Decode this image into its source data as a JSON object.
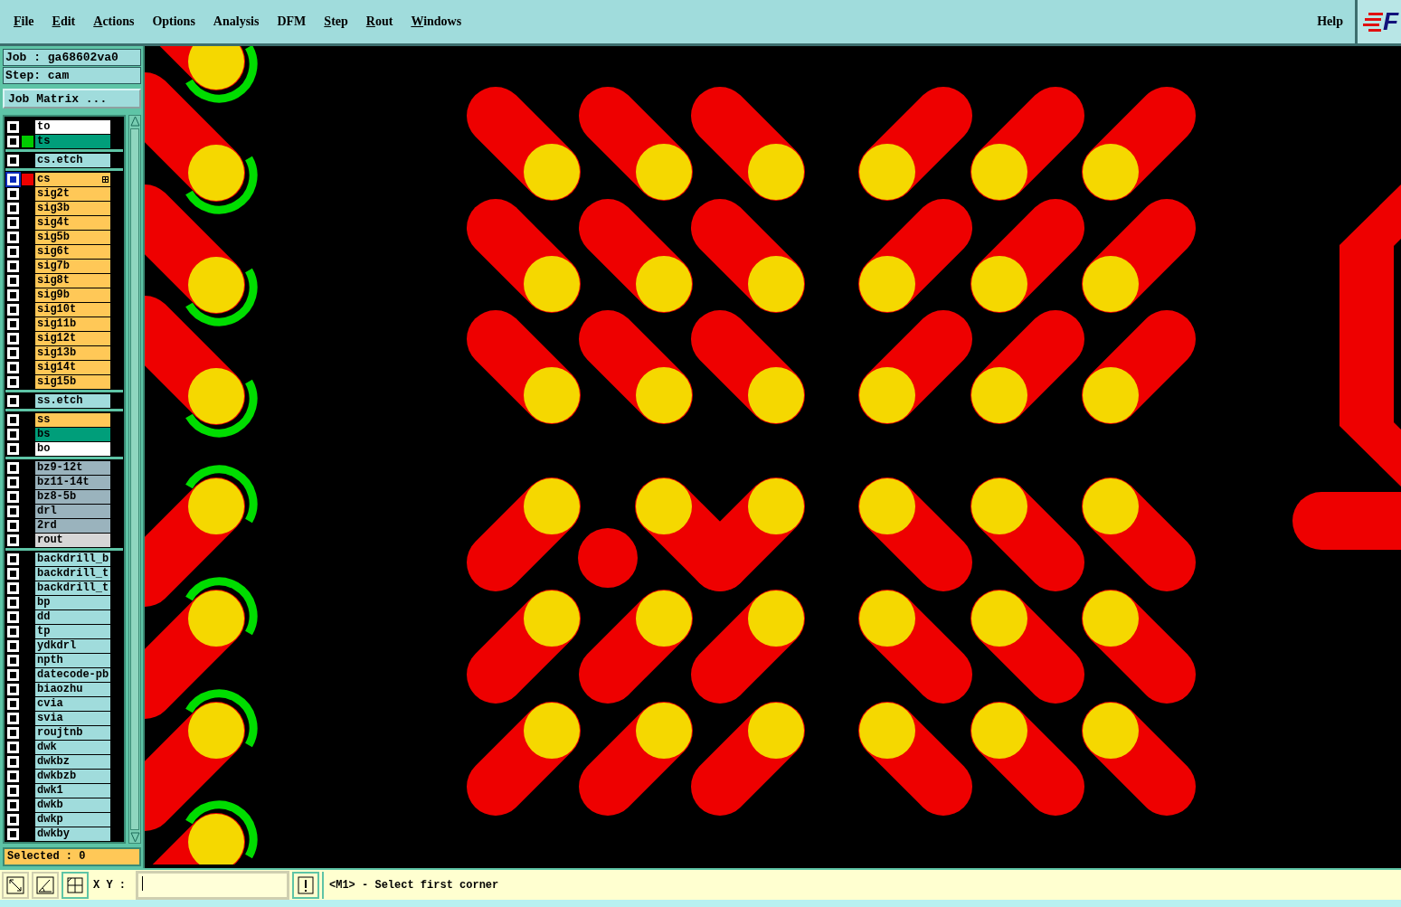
{
  "menu_bar": {
    "items": [
      {
        "label": "File",
        "mnemonic": true
      },
      {
        "label": "Edit",
        "mnemonic": true
      },
      {
        "label": "Actions",
        "mnemonic": true
      },
      {
        "label": "Options",
        "mnemonic": false
      },
      {
        "label": "Analysis",
        "mnemonic": false
      },
      {
        "label": "DFM",
        "mnemonic": false
      },
      {
        "label": "Step",
        "mnemonic": true
      },
      {
        "label": "Rout",
        "mnemonic": true
      },
      {
        "label": "Windows",
        "mnemonic": true
      }
    ],
    "help": "Help",
    "logo": "F"
  },
  "job": {
    "job_label": "Job : ga68602va0",
    "step_label": "Step: cam",
    "matrix_button": "Job Matrix ..."
  },
  "layer_groups": [
    {
      "layers": [
        {
          "name": "to",
          "kind": "silk",
          "selected": false
        },
        {
          "name": "ts",
          "kind": "mask",
          "selected": false,
          "color": "#00cc00"
        }
      ]
    },
    {
      "layers": [
        {
          "name": "cs.etch",
          "kind": "etch",
          "selected": false
        }
      ]
    },
    {
      "layers": [
        {
          "name": "cs",
          "kind": "signal",
          "selected": true,
          "color": "#ee0000",
          "work_layer": true
        },
        {
          "name": "sig2t",
          "kind": "signal",
          "selected": false
        },
        {
          "name": "sig3b",
          "kind": "signal",
          "selected": false
        },
        {
          "name": "sig4t",
          "kind": "signal",
          "selected": false
        },
        {
          "name": "sig5b",
          "kind": "signal",
          "selected": false
        },
        {
          "name": "sig6t",
          "kind": "signal",
          "selected": false
        },
        {
          "name": "sig7b",
          "kind": "signal",
          "selected": false
        },
        {
          "name": "sig8t",
          "kind": "signal",
          "selected": false
        },
        {
          "name": "sig9b",
          "kind": "signal",
          "selected": false
        },
        {
          "name": "sig10t",
          "kind": "signal",
          "selected": false
        },
        {
          "name": "sig11b",
          "kind": "signal",
          "selected": false
        },
        {
          "name": "sig12t",
          "kind": "signal",
          "selected": false
        },
        {
          "name": "sig13b",
          "kind": "signal",
          "selected": false
        },
        {
          "name": "sig14t",
          "kind": "signal",
          "selected": false
        },
        {
          "name": "sig15b",
          "kind": "signal",
          "selected": false
        }
      ]
    },
    {
      "layers": [
        {
          "name": "ss.etch",
          "kind": "etch",
          "selected": false
        }
      ]
    },
    {
      "layers": [
        {
          "name": "ss",
          "kind": "signal",
          "selected": false
        },
        {
          "name": "bs",
          "kind": "mask",
          "selected": false
        },
        {
          "name": "bo",
          "kind": "silk",
          "selected": false
        }
      ]
    },
    {
      "layers": [
        {
          "name": "bz9-12t",
          "kind": "drill",
          "selected": false
        },
        {
          "name": "bz11-14t",
          "kind": "drill",
          "selected": false
        },
        {
          "name": "bz8-5b",
          "kind": "drill",
          "selected": false
        },
        {
          "name": "drl",
          "kind": "drill",
          "selected": false
        },
        {
          "name": "2rd",
          "kind": "drill",
          "selected": false
        },
        {
          "name": "rout",
          "kind": "rout",
          "selected": false
        }
      ]
    },
    {
      "layers": [
        {
          "name": "backdrill_b",
          "kind": "misc",
          "selected": false
        },
        {
          "name": "backdrill_t",
          "kind": "misc",
          "selected": false
        },
        {
          "name": "backdrill_t",
          "kind": "misc",
          "selected": false
        },
        {
          "name": "bp",
          "kind": "misc",
          "selected": false
        },
        {
          "name": "dd",
          "kind": "misc",
          "selected": false
        },
        {
          "name": "tp",
          "kind": "misc",
          "selected": false
        },
        {
          "name": "ydkdrl",
          "kind": "misc",
          "selected": false
        },
        {
          "name": "npth",
          "kind": "misc",
          "selected": false
        },
        {
          "name": "datecode-pb",
          "kind": "misc",
          "selected": false
        },
        {
          "name": "biaozhu",
          "kind": "misc",
          "selected": false
        },
        {
          "name": "cvia",
          "kind": "misc",
          "selected": false
        },
        {
          "name": "svia",
          "kind": "misc",
          "selected": false
        },
        {
          "name": "roujtnb",
          "kind": "misc",
          "selected": false
        },
        {
          "name": "dwk",
          "kind": "misc",
          "selected": false
        },
        {
          "name": "dwkbz",
          "kind": "misc",
          "selected": false
        },
        {
          "name": "dwkbzb",
          "kind": "misc",
          "selected": false
        },
        {
          "name": "dwk1",
          "kind": "misc",
          "selected": false
        },
        {
          "name": "dwkb",
          "kind": "misc",
          "selected": false
        },
        {
          "name": "dwkp",
          "kind": "misc",
          "selected": false
        },
        {
          "name": "dwkby",
          "kind": "misc",
          "selected": false
        }
      ]
    }
  ],
  "selected_count": "Selected : 0",
  "bottom_bar": {
    "xy_label": "X Y :",
    "message": "<M1> - Select first corner"
  }
}
